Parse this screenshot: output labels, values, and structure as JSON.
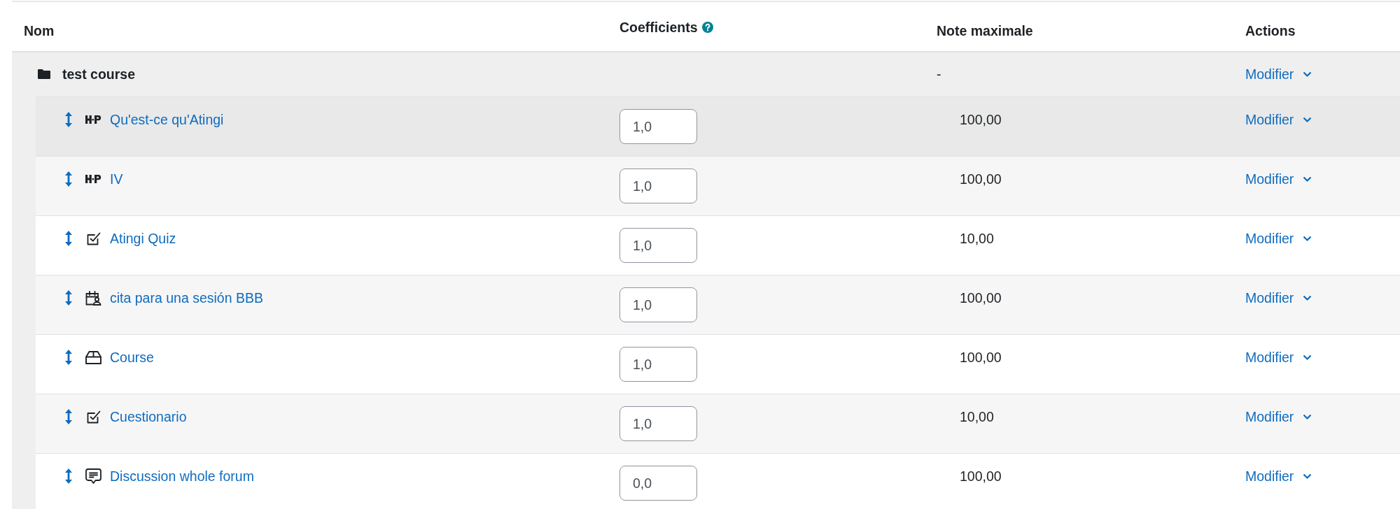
{
  "table": {
    "columns": [
      {
        "label": "Nom",
        "help": false
      },
      {
        "label": "Coefficients",
        "help": true
      },
      {
        "label": "Note maximale",
        "help": false
      },
      {
        "label": "Actions",
        "help": false
      }
    ],
    "category": {
      "name": "test course",
      "max_grade": "-",
      "action": "Modifier"
    },
    "items": [
      {
        "kind": "h5p",
        "name": "Qu'est-ce qu'Atingi",
        "weight": "1,0",
        "max_grade": "100,00",
        "action": "Modifier",
        "hovered": true
      },
      {
        "kind": "h5p",
        "name": "IV",
        "weight": "1,0",
        "max_grade": "100,00",
        "action": "Modifier",
        "hovered": false
      },
      {
        "kind": "quiz",
        "name": "Atingi Quiz",
        "weight": "1,0",
        "max_grade": "10,00",
        "action": "Modifier",
        "hovered": false
      },
      {
        "kind": "scheduler",
        "name": "cita para una sesión BBB",
        "weight": "1,0",
        "max_grade": "100,00",
        "action": "Modifier",
        "hovered": false
      },
      {
        "kind": "course",
        "name": "Course",
        "weight": "1,0",
        "max_grade": "100,00",
        "action": "Modifier",
        "hovered": false
      },
      {
        "kind": "quiz",
        "name": "Cuestionario",
        "weight": "1,0",
        "max_grade": "10,00",
        "action": "Modifier",
        "hovered": false
      },
      {
        "kind": "forum",
        "name": "Discussion whole forum",
        "weight": "0,0",
        "max_grade": "100,00",
        "action": "Modifier",
        "hovered": false
      }
    ]
  }
}
